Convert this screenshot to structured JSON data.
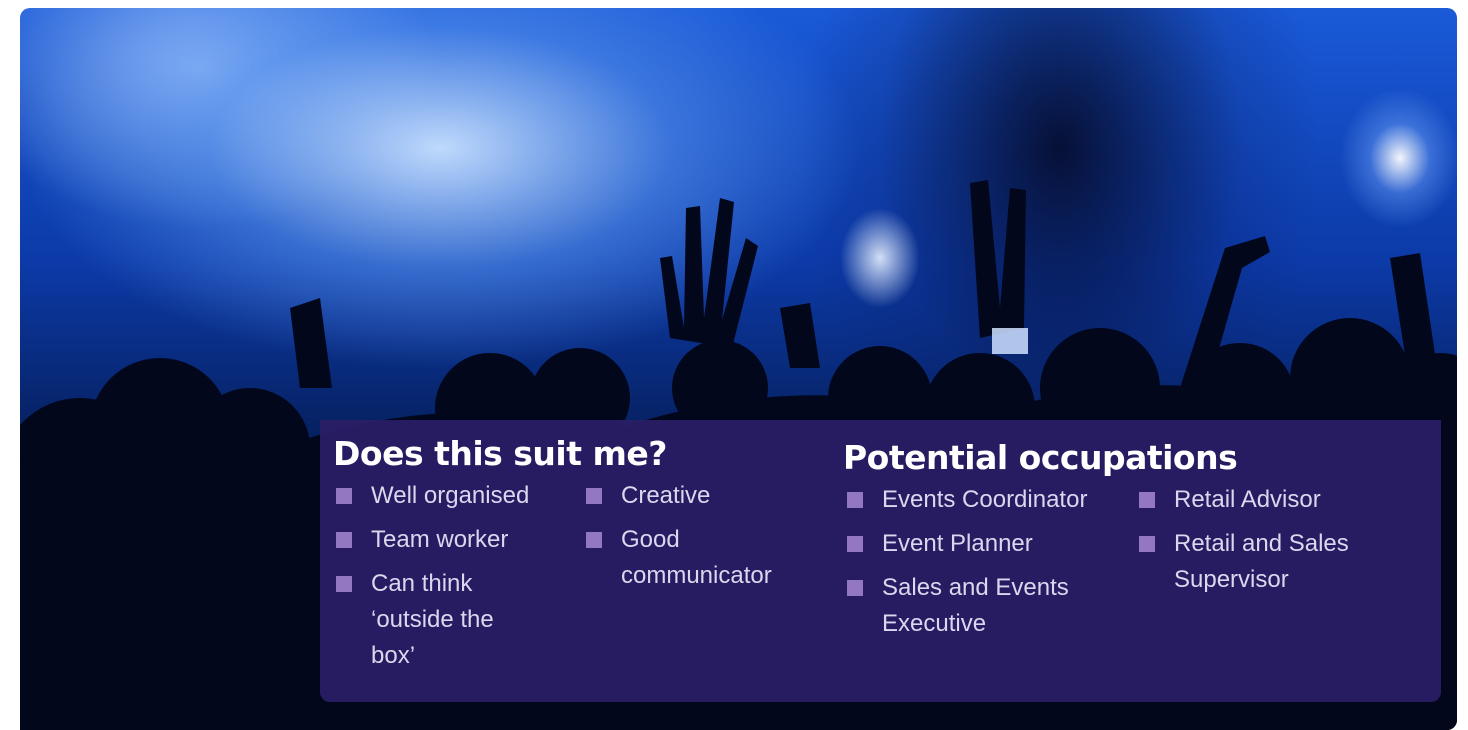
{
  "suit": {
    "heading": "Does this suit me?",
    "column1": [
      {
        "label": "Well organised"
      },
      {
        "label": "Team worker"
      },
      {
        "label": "Can think ‘outside the box’"
      }
    ],
    "column2": [
      {
        "label": "Creative"
      },
      {
        "label": "Good communicator"
      }
    ]
  },
  "occupations": {
    "heading": "Potential occupations",
    "column1": [
      {
        "label": "Events Coordinator"
      },
      {
        "label": "Event Planner"
      },
      {
        "label": "Sales and Events Executive"
      }
    ],
    "column2": [
      {
        "label": "Retail Advisor"
      },
      {
        "label": "Retail and Sales Supervisor"
      }
    ]
  },
  "colors": {
    "panel": "#2a1e66",
    "bullet": "#9377c0",
    "heading_text": "#ffffff",
    "item_text": "#dcd6ee"
  },
  "icons": {
    "bullet": "square-bullet-icon"
  }
}
